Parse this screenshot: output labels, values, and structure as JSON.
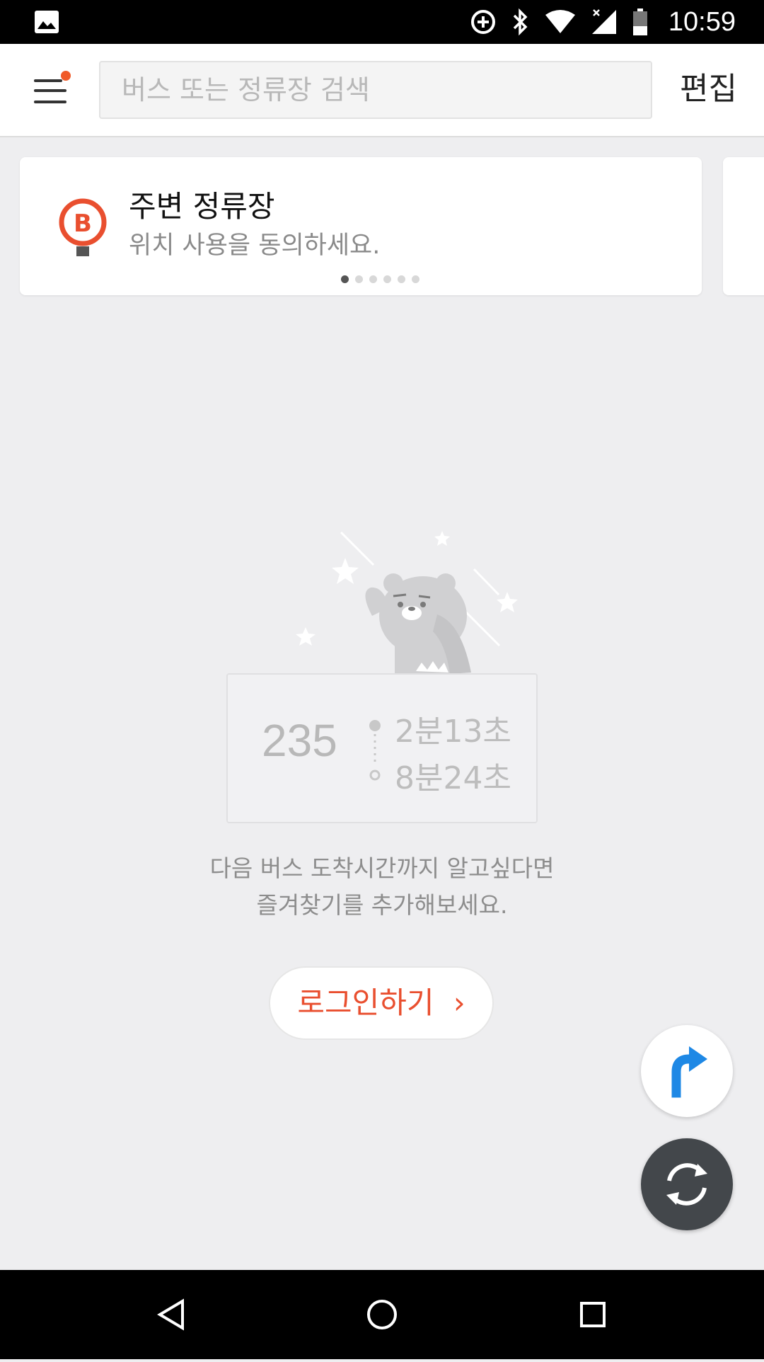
{
  "status_bar": {
    "time": "10:59",
    "icons": [
      "image-icon",
      "data-saver-icon",
      "bluetooth-icon",
      "wifi-icon",
      "signal-icon",
      "battery-icon"
    ]
  },
  "header": {
    "search_placeholder": "버스 또는 정류장 검색",
    "edit_label": "편집",
    "menu_badge_color": "#f05a28"
  },
  "nearby_card": {
    "title": "주변 정류장",
    "subtitle": "위치 사용을 동의하세요.",
    "icon": "bus-stop-icon",
    "page_count": 6,
    "active_page": 1
  },
  "empty_state": {
    "example_bus_number": "235",
    "example_time_1": "2분13초",
    "example_time_2": "8분24초",
    "message_line_1": "다음 버스 도착시간까지 알고싶다면",
    "message_line_2": "즐겨찾기를 추가해보세요.",
    "login_label": "로그인하기",
    "login_chevron": "›"
  },
  "fabs": {
    "route_icon": "route-arrow-icon",
    "refresh_icon": "refresh-icon"
  },
  "nav_bar": {
    "buttons": [
      "back-icon",
      "home-icon",
      "recents-icon"
    ]
  },
  "colors": {
    "accent": "#e94f2f",
    "background": "#eeeef0",
    "route_blue": "#1e88e5",
    "fab_dark": "#43474b"
  }
}
